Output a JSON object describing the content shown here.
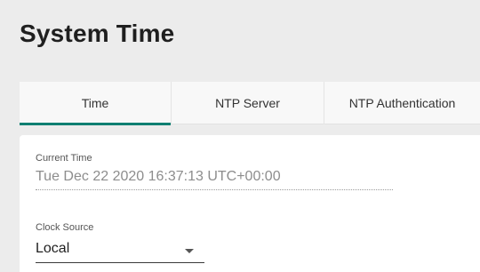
{
  "page": {
    "title": "System Time"
  },
  "tabs": [
    {
      "label": "Time",
      "active": true
    },
    {
      "label": "NTP Server",
      "active": false
    },
    {
      "label": "NTP Authentication",
      "active": false
    }
  ],
  "form": {
    "current_time": {
      "label": "Current Time",
      "value": "Tue Dec 22 2020 16:37:13 UTC+00:00"
    },
    "clock_source": {
      "label": "Clock Source",
      "value": "Local",
      "icon": "chevron-down-icon"
    }
  },
  "colors": {
    "accent": "#0f7f72",
    "background": "#ececec",
    "panel": "#ffffff",
    "readonly_text": "#8d8d8d"
  }
}
